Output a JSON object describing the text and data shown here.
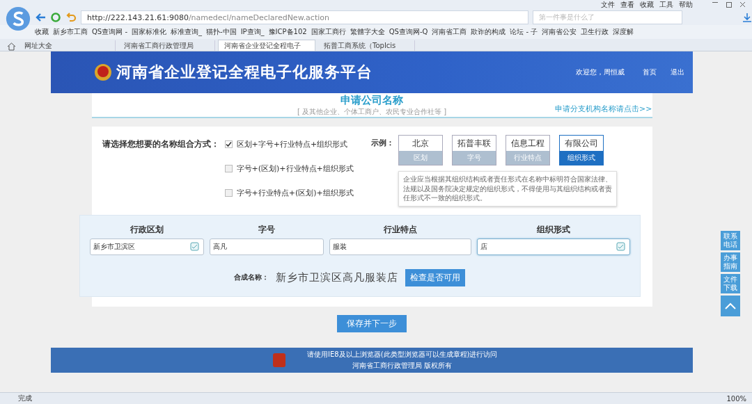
{
  "browser": {
    "menu": [
      "文件",
      "查看",
      "收藏",
      "工具",
      "帮助"
    ],
    "address": {
      "host": "http://222.143.21.61:9080",
      "path": "/namedecl/nameDeclaredNew.action"
    },
    "search": {
      "placeholder": "第一件事是什么了"
    },
    "bookmarks": [
      "收藏",
      "新乡市工商",
      "QS查询网 -",
      "国家标准化",
      "标准查询_",
      "猫扑-中国",
      "IP查询_",
      "豫ICP备102",
      "国家工商行",
      "繁體字大全",
      "QS查询网-Q",
      "河南省工商",
      "欺诈的构成",
      "论坛 - 子",
      "河南省公安",
      "卫生行政",
      "深度解"
    ],
    "tabs": [
      {
        "label": "网址大全",
        "selected": false
      },
      {
        "label": "河南省工商行政管理局",
        "selected": false
      },
      {
        "label": "河南省企业登记全程电子",
        "selected": true
      },
      {
        "label": "拓普工商系统（TopIcis",
        "selected": false
      }
    ]
  },
  "header": {
    "title": "河南省企业登记全程电子化服务平台",
    "user": "欢迎您，周恒威",
    "links": [
      "首页",
      "退出"
    ]
  },
  "section": {
    "title": "申请公司名称",
    "subtitle": "[ 及其他企业、个体工商户、农民专业合作社等 ]",
    "branch_link": "申请分支机构名称请点击>>"
  },
  "form": {
    "prompt": "请选择您想要的名称组合方式：",
    "options": [
      {
        "label": "区划+字号+行业特点+组织形式",
        "checked": true
      },
      {
        "label": "字号+(区划)+行业特点+组织形式",
        "checked": false
      },
      {
        "label": "字号+行业特点+(区划)+组织形式",
        "checked": false
      }
    ],
    "example_label": "示例：",
    "examples": [
      {
        "word": "北京",
        "part": "区划",
        "selected": false
      },
      {
        "word": "拓普丰联",
        "part": "字号",
        "selected": false
      },
      {
        "word": "信息工程",
        "part": "行业特点",
        "selected": false
      },
      {
        "word": "有限公司",
        "part": "组织形式",
        "selected": true
      }
    ],
    "tip": "企业应当根据其组织结构或者责任形式在名称中标明符合国家法律、法规以及国务院决定规定的组织形式，不得使用与其组织结构或者责任形式不一致的组织形式。",
    "fields": [
      {
        "label": "行政区划",
        "value": "新乡市卫滨区",
        "picker": true,
        "focused": false
      },
      {
        "label": "字号",
        "value": "高凡",
        "picker": false,
        "focused": false
      },
      {
        "label": "行业特点",
        "value": "服装",
        "picker": false,
        "focused": false
      },
      {
        "label": "组织形式",
        "value": "店",
        "picker": true,
        "focused": true
      }
    ],
    "combined_label": "合成名称：",
    "combined_value": "新乡市卫滨区高凡服装店",
    "check_button": "检查是否可用",
    "save_button": "保存并下一步"
  },
  "side_buttons": [
    "联系电话",
    "办事指南",
    "文件下载"
  ],
  "footer": [
    "请使用IE8及以上浏览器(此类型浏览器可以生成章程)进行访问",
    "河南省工商行政管理局 版权所有"
  ],
  "status_bar": {
    "text": "完成",
    "zoom": "100%"
  }
}
